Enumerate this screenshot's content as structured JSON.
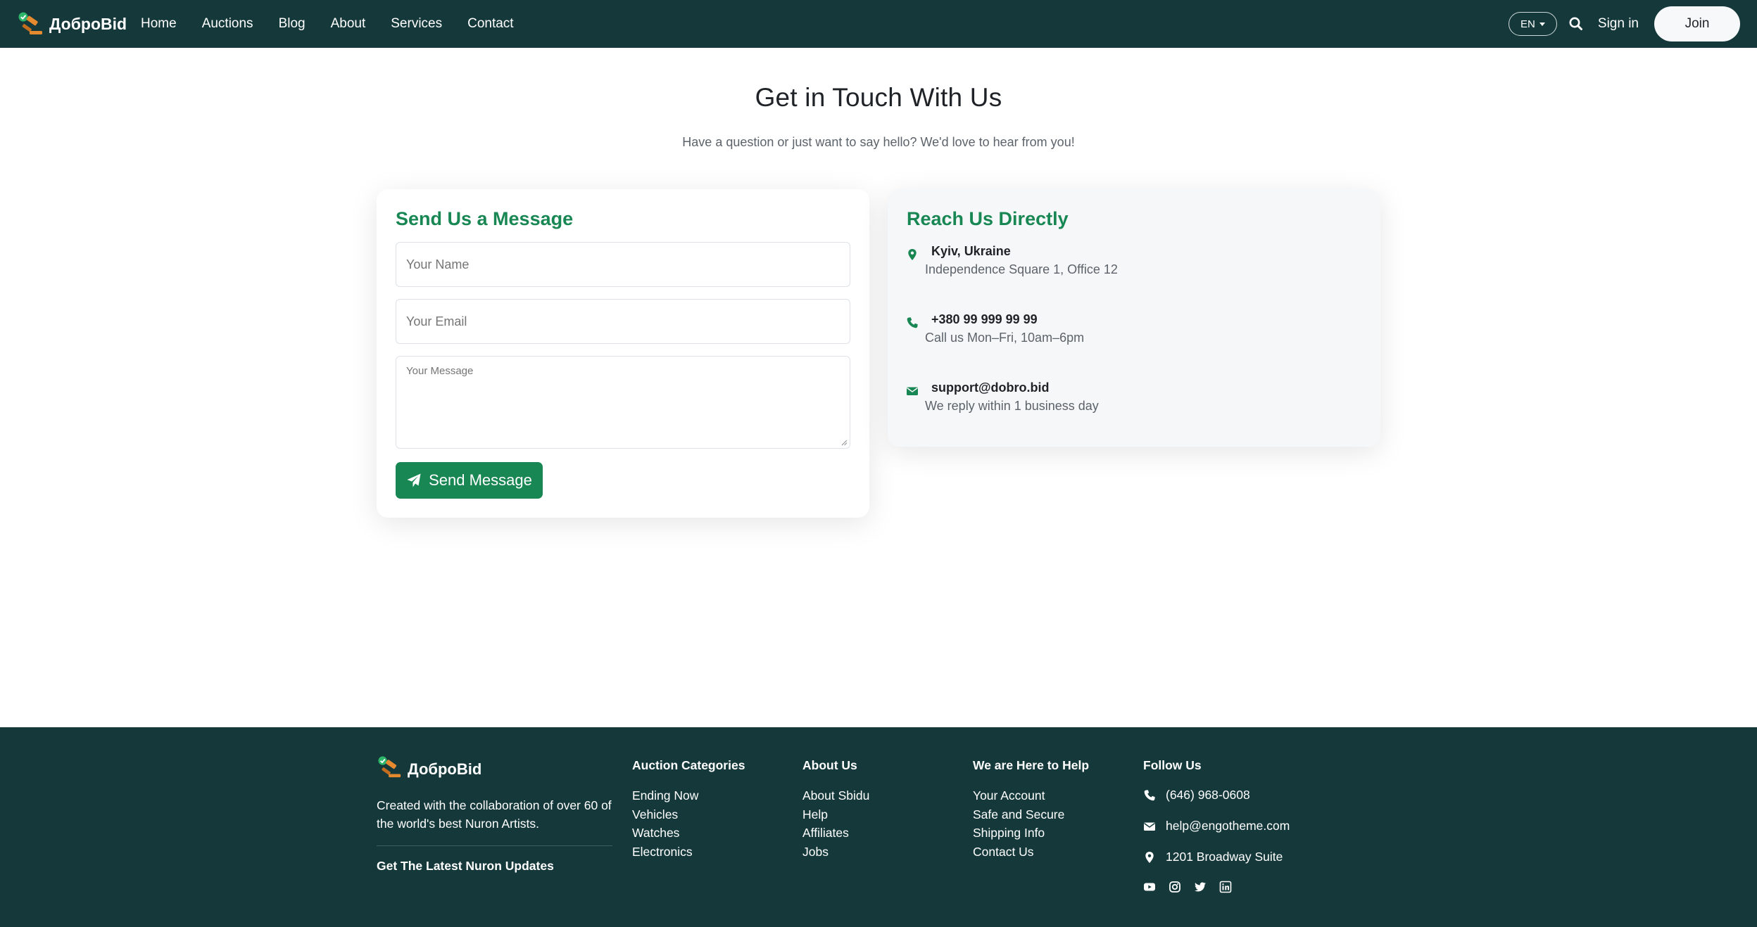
{
  "nav": {
    "brand": "ДоброBid",
    "links": [
      "Home",
      "Auctions",
      "Blog",
      "About",
      "Services",
      "Contact"
    ],
    "lang": "EN",
    "signin": "Sign in",
    "join": "Join"
  },
  "header": {
    "title": "Get in Touch With Us",
    "subtitle": "Have a question or just want to say hello? We'd love to hear from you!"
  },
  "form": {
    "title": "Send Us a Message",
    "name_placeholder": "Your Name",
    "email_placeholder": "Your Email",
    "message_placeholder": "Your Message",
    "submit": "Send Message"
  },
  "contact": {
    "title": "Reach Us Directly",
    "items": [
      {
        "icon": "map-marker-icon",
        "primary": "Kyiv, Ukraine",
        "secondary": "Independence Square 1, Office 12"
      },
      {
        "icon": "phone-icon",
        "primary": "+380 99 999 99 99",
        "secondary": "Call us Mon–Fri, 10am–6pm"
      },
      {
        "icon": "envelope-icon",
        "primary": "support@dobro.bid",
        "secondary": "We reply within 1 business day"
      }
    ]
  },
  "footer": {
    "brand": "ДоброBid",
    "description": "Created with the collaboration of over 60 of the world's best Nuron Artists.",
    "updates": "Get The Latest Nuron Updates",
    "columns": [
      {
        "title": "Auction Categories",
        "links": [
          "Ending Now",
          "Vehicles",
          "Watches",
          "Electronics"
        ]
      },
      {
        "title": "About Us",
        "links": [
          "About Sbidu",
          "Help",
          "Affiliates",
          "Jobs"
        ]
      },
      {
        "title": "We are Here to Help",
        "links": [
          "Your Account",
          "Safe and Secure",
          "Shipping Info",
          "Contact Us"
        ]
      }
    ],
    "follow": {
      "title": "Follow Us",
      "phone": "(646) 968-0608",
      "email": "help@engotheme.com",
      "address": "1201 Broadway Suite",
      "socials": [
        "youtube-icon",
        "instagram-icon",
        "twitter-icon",
        "linkedin-icon"
      ]
    }
  },
  "colors": {
    "nav_bg": "#15393b",
    "accent": "#198754",
    "footer_bg": "#15393b"
  }
}
